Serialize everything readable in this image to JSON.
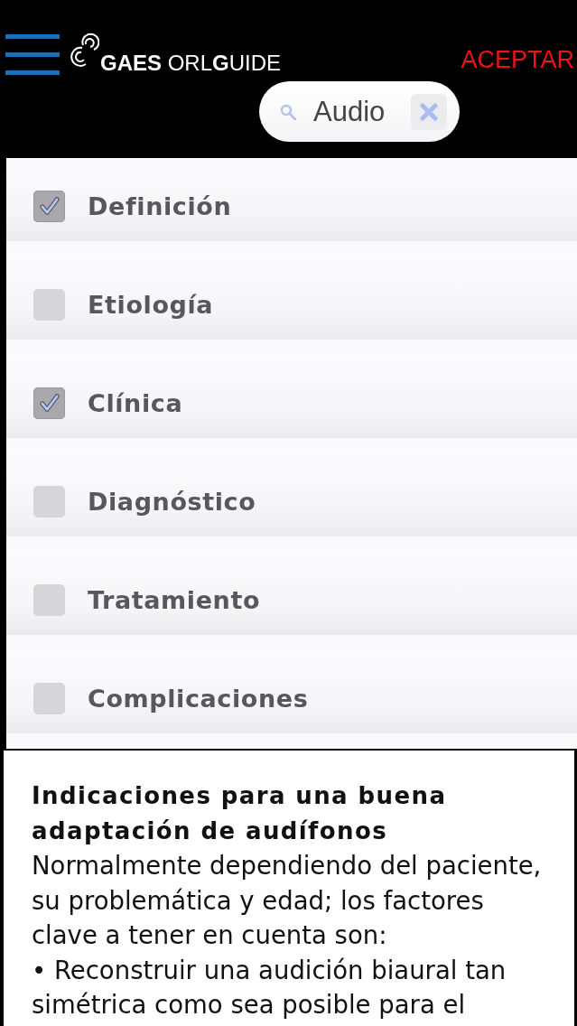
{
  "header": {
    "logo": "**GAES** ORL**G**UIDE",
    "accept_button": "ACEPTAR"
  },
  "search": {
    "value": "Audio"
  },
  "filters": [
    {
      "label": "Definición",
      "checked": true
    },
    {
      "label": "Etiología",
      "checked": false
    },
    {
      "label": "Clínica",
      "checked": true
    },
    {
      "label": "Diagnóstico",
      "checked": false
    },
    {
      "label": "Tratamiento",
      "checked": false
    },
    {
      "label": "Complicaciones",
      "checked": false
    }
  ],
  "article": {
    "title": "Indicaciones para una buena adaptación de audífonos",
    "paragraphs": [
      "Normalmente dependiendo del paciente, su problemática y edad; los factores clave a tener en cuenta son:",
      "• Reconstruir una audición biaural tan simétrica como sea posible para el"
    ]
  }
}
